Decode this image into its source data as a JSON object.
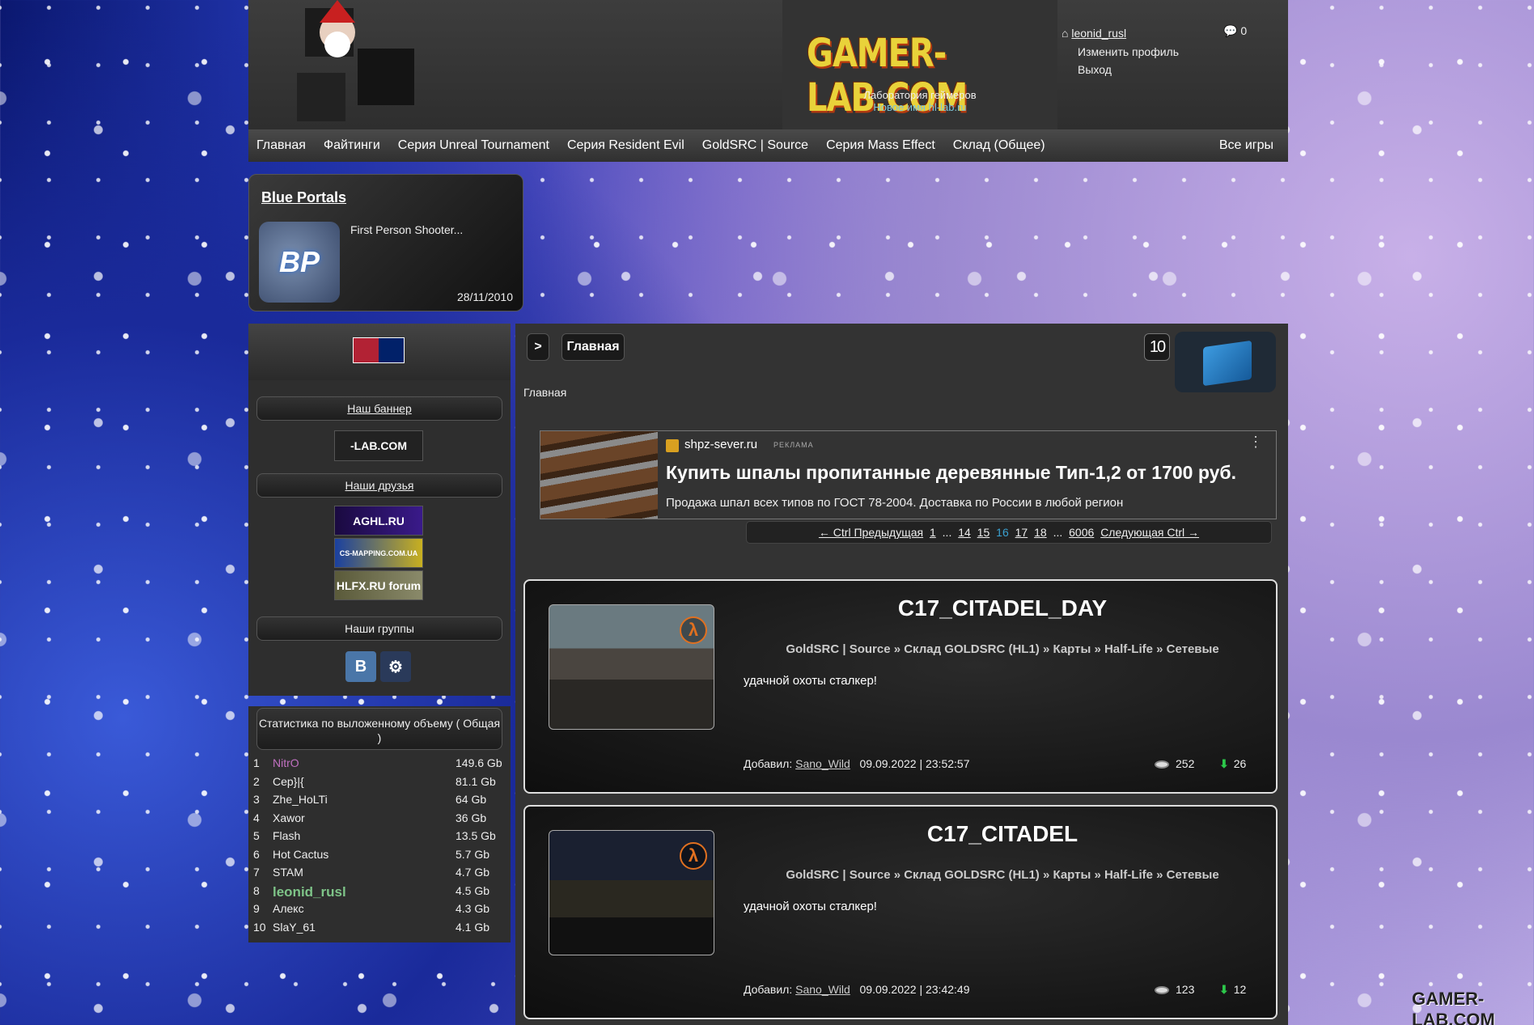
{
  "header": {
    "logo_text": "GAMER-LAB.COM",
    "logo_subtitle": "Лаборатория геймеров",
    "logo_subtitle2": "Новое имя hl-lab.ru"
  },
  "user": {
    "name": "leonid_rusl",
    "edit_profile": "Изменить профиль",
    "logout": "Выход",
    "messages_count": "0"
  },
  "nav": {
    "items": [
      "Главная",
      "Файтинги",
      "Серия Unreal Tournament",
      "Серия Resident Evil",
      "GoldSRC | Source",
      "Серия Mass Effect",
      "Склад (Общее)"
    ],
    "all_games": "Все игры"
  },
  "featured": {
    "title": "Blue Portals",
    "icon_text": "BP",
    "description": "First Person Shooter...",
    "date": "28/11/2010"
  },
  "sidebar": {
    "banner_heading": "Наш баннер",
    "banner_text": "-LAB.COM",
    "friends_heading": "Наши друзья",
    "friends": [
      "AGHL.RU",
      "CS-MAPPING.COM.UA",
      "HLFX.RU forum"
    ],
    "groups_heading": "Наши группы",
    "group_vk": "B"
  },
  "stats": {
    "heading": "Статистика по выложенному объему ( Общая )",
    "rows": [
      {
        "n": "1",
        "name": "NitrO",
        "value": "149.6 Gb",
        "color": "#c070c0"
      },
      {
        "n": "2",
        "name": "Cep}|{",
        "value": "81.1 Gb",
        "color": "#eeeeee"
      },
      {
        "n": "3",
        "name": "Zhe_HoLTi",
        "value": "64 Gb",
        "color": "#eeeeee"
      },
      {
        "n": "4",
        "name": "Xawor",
        "value": "36 Gb",
        "color": "#eeeeee"
      },
      {
        "n": "5",
        "name": "Flash",
        "value": "13.5 Gb",
        "color": "#eeeeee"
      },
      {
        "n": "6",
        "name": "Hot Cactus",
        "value": "5.7 Gb",
        "color": "#eeeeee"
      },
      {
        "n": "7",
        "name": "STAM",
        "value": "4.7 Gb",
        "color": "#eeeeee"
      },
      {
        "n": "8",
        "name": "leonid_rusl",
        "value": "4.5 Gb",
        "color": "#7ec488"
      },
      {
        "n": "9",
        "name": "Алекс",
        "value": "4.3 Gb",
        "color": "#eeeeee"
      },
      {
        "n": "10",
        "name": "SlaY_61",
        "value": "4.1 Gb",
        "color": "#eeeeee"
      }
    ]
  },
  "main": {
    "breadcrumb_arrow": ">",
    "breadcrumb_title": "Главная",
    "count_badge": "10",
    "subtitle": "Главная"
  },
  "ad": {
    "domain": "shpz-sever.ru",
    "tag": "РЕКЛАМА",
    "title": "Купить шпалы пропитанные деревянные Тип-1,2 от 1700 руб.",
    "description": "Продажа шпал всех типов по ГОСТ 78-2004. Доставка по России в любой регион",
    "menu": "⋮"
  },
  "pager": {
    "prev": "← Ctrl Предыдущая",
    "first": "1",
    "ellipsis1": "...",
    "p14": "14",
    "p15": "15",
    "current": "16",
    "p17": "17",
    "p18": "18",
    "ellipsis2": "...",
    "last": "6006",
    "next": "Следующая Ctrl →"
  },
  "posts": [
    {
      "title": "C17_CITADEL_DAY",
      "path": "GoldSRC | Source » Склад GOLDSRC (HL1) » Карты » Half-Life » Сетевые",
      "text": "удачной охоты сталкер!",
      "added_label": "Добавил:",
      "author": "Sano_Wild",
      "datetime": "09.09.2022 | 23:52:57",
      "views": "252",
      "downloads": "26",
      "badge": "λ"
    },
    {
      "title": "C17_CITADEL",
      "path": "GoldSRC | Source » Склад GOLDSRC (HL1) » Карты » Half-Life » Сетевые",
      "text": "удачной охоты сталкер!",
      "added_label": "Добавил:",
      "author": "Sano_Wild",
      "datetime": "09.09.2022 | 23:42:49",
      "views": "123",
      "downloads": "12",
      "badge": "λ"
    }
  ],
  "corner_logo": "GAMER-LAB.COM",
  "colors": {
    "accent": "#3aa0d0",
    "download": "#2cc84a",
    "highlight_user": "#7ec488"
  }
}
